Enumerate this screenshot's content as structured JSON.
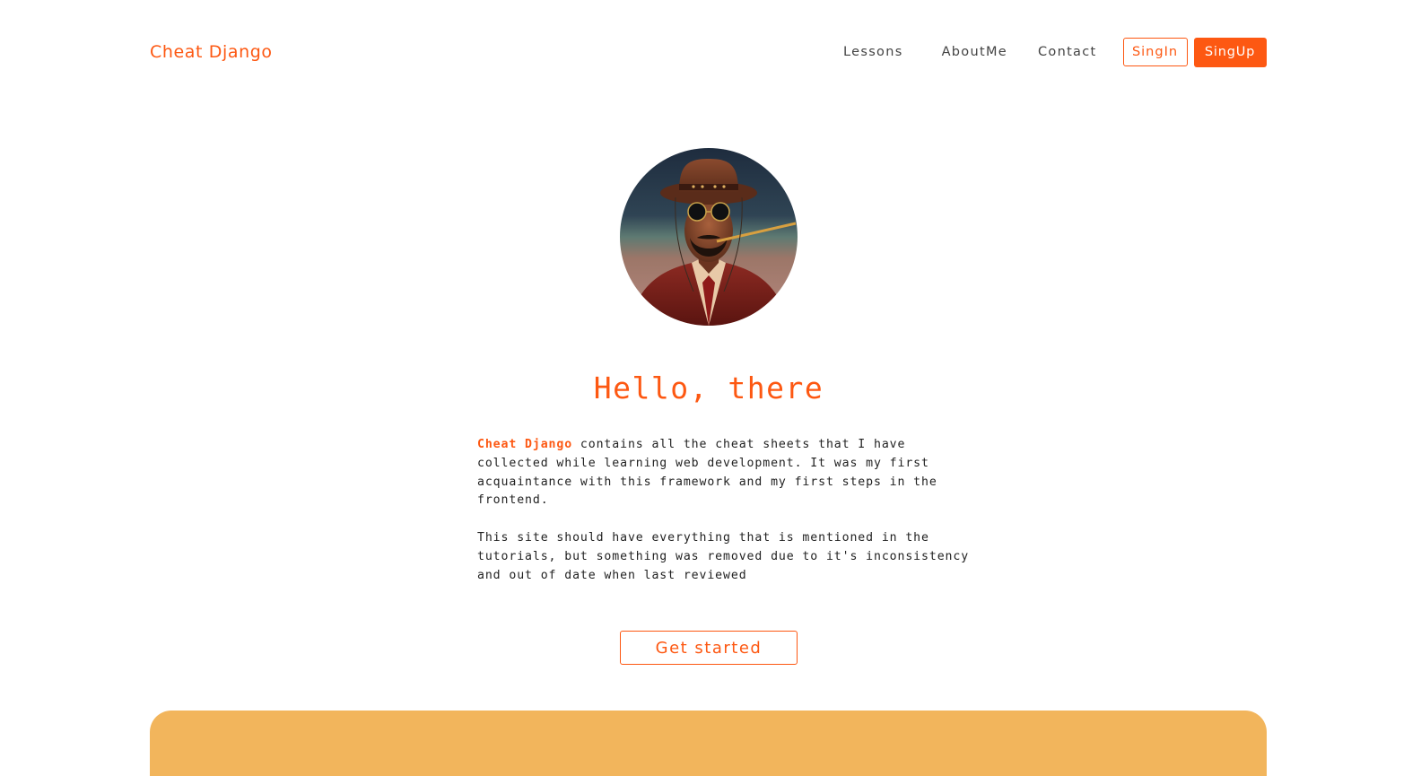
{
  "header": {
    "brand": "Cheat Django",
    "nav": {
      "lessons": "Lessons",
      "about": "AboutMe",
      "contact": "Contact"
    },
    "signin_label": "SingIn",
    "signup_label": "SingUp"
  },
  "hero": {
    "avatar_icon": "django-portrait-avatar",
    "title": "Hello, there",
    "intro_brand": "Cheat Django",
    "intro_p1_rest": " contains all the cheat sheets that I have collected while learning web development. It was my first acquaintance with this framework and my first steps in the frontend.",
    "intro_p2": "This site should have everything that is mentioned in the tutorials, but something was removed due to it's inconsistency and out of date when last reviewed",
    "cta_label": "Get started"
  },
  "colors": {
    "accent": "#fd5812",
    "panel": "#f2b55c",
    "text": "#222222"
  }
}
